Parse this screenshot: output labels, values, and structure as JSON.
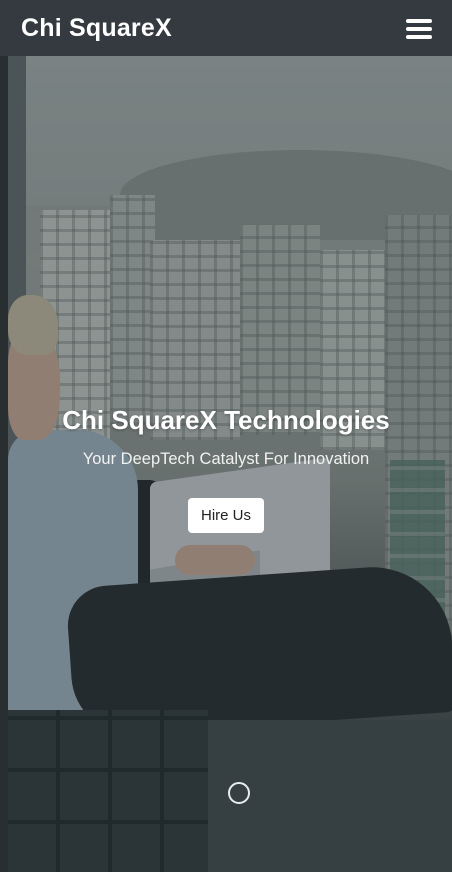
{
  "navbar": {
    "brand": "Chi SquareX",
    "menu_icon": "hamburger-menu-icon"
  },
  "hero": {
    "title": "Chi SquareX Technologies",
    "subtitle": "Your DeepTech Catalyst For Innovation",
    "cta_label": "Hire Us"
  },
  "carousel": {
    "indicator_icon": "carousel-indicator-circle"
  },
  "colors": {
    "navbar_bg": "#343a40",
    "text_light": "#ffffff",
    "button_bg": "#ffffff"
  }
}
